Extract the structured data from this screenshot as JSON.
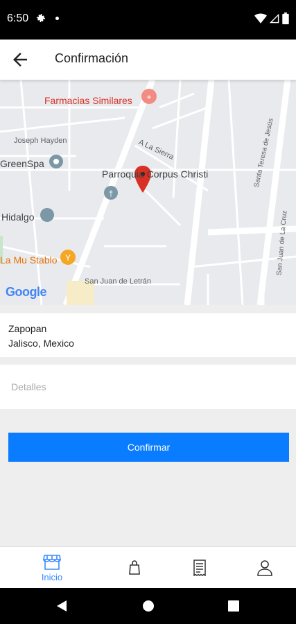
{
  "status_bar": {
    "time": "6:50"
  },
  "app_bar": {
    "title": "Confirmación"
  },
  "map": {
    "labels": {
      "farmacias": "Farmacias Similares",
      "joseph": "Joseph Hayden",
      "lasierra": "A La Sierra",
      "greenspa": "GreenSpa",
      "parroquia": "Parroquia Corpus Christi",
      "hidalgo": "Hidalgo",
      "mustablo": "La Mu Stablo",
      "sanjuan": "San Juan de Letrán",
      "santateresa": "Santa Teresa de Jesús",
      "sanjuanlacruz": "San Juan de La Cruz"
    },
    "attribution": "Google"
  },
  "address": {
    "line1": "Zapopan",
    "line2": "Jalisco, Mexico"
  },
  "details": {
    "placeholder": "Detalles",
    "value": ""
  },
  "confirm": {
    "label": "Confirmar"
  },
  "bottom_nav": {
    "items": [
      {
        "label": "Inicio",
        "icon": "store-icon",
        "active": true
      },
      {
        "label": "",
        "icon": "shopping-bag-icon",
        "active": false
      },
      {
        "label": "",
        "icon": "receipt-icon",
        "active": false
      },
      {
        "label": "",
        "icon": "person-icon",
        "active": false
      }
    ]
  },
  "colors": {
    "primary": "#0a7cff",
    "nav_active": "#3a8bff",
    "pin": "#d93025"
  }
}
